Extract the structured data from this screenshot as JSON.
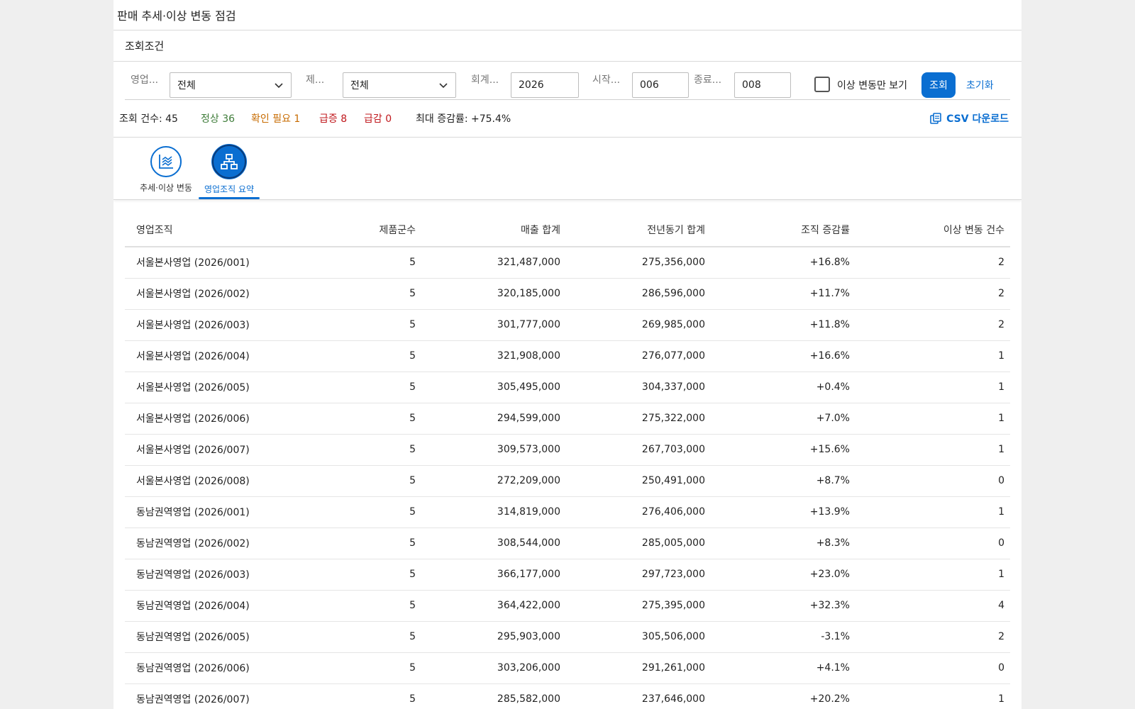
{
  "app": {
    "title": "판매 추세·이상 변동 점검"
  },
  "filters": {
    "header": "조회조건",
    "org_label": "영업...",
    "org_value": "전체",
    "product_label": "제...",
    "product_value": "전체",
    "year_label": "회계...",
    "year_value": "2026",
    "start_label": "시작...",
    "start_value": "006",
    "end_label": "종료...",
    "end_value": "008",
    "anomaly_only_label": "이상 변동만 보기",
    "anomaly_only_checked": false,
    "search_button": "조회",
    "reset_button": "초기화"
  },
  "summary": {
    "count": "조회 건수: 45",
    "normal": "정상 36",
    "check": "확인 필요 1",
    "surge": "급증 8",
    "drop": "급감 0",
    "max_rate": "최대 증감률: +75.4%",
    "csv": "CSV 다운로드",
    "colors": {
      "normal": "#3f7d3a",
      "check": "#c76b00",
      "surge": "#c0181d",
      "drop": "#c0181d"
    }
  },
  "tabs": [
    {
      "label": "추세·이상 변동",
      "icon": "trend-chart-icon",
      "active": false
    },
    {
      "label": "영업조직 요약",
      "icon": "org-hierarchy-icon",
      "active": true
    }
  ],
  "table": {
    "headers": [
      "영업조직",
      "제품군수",
      "매출 합계",
      "전년동기 합계",
      "조직 증감률",
      "이상 변동 건수"
    ],
    "rows": [
      [
        "서울본사영업 (2026/001)",
        "5",
        "321,487,000",
        "275,356,000",
        "+16.8%",
        "2"
      ],
      [
        "서울본사영업 (2026/002)",
        "5",
        "320,185,000",
        "286,596,000",
        "+11.7%",
        "2"
      ],
      [
        "서울본사영업 (2026/003)",
        "5",
        "301,777,000",
        "269,985,000",
        "+11.8%",
        "2"
      ],
      [
        "서울본사영업 (2026/004)",
        "5",
        "321,908,000",
        "276,077,000",
        "+16.6%",
        "1"
      ],
      [
        "서울본사영업 (2026/005)",
        "5",
        "305,495,000",
        "304,337,000",
        "+0.4%",
        "1"
      ],
      [
        "서울본사영업 (2026/006)",
        "5",
        "294,599,000",
        "275,322,000",
        "+7.0%",
        "1"
      ],
      [
        "서울본사영업 (2026/007)",
        "5",
        "309,573,000",
        "267,703,000",
        "+15.6%",
        "1"
      ],
      [
        "서울본사영업 (2026/008)",
        "5",
        "272,209,000",
        "250,491,000",
        "+8.7%",
        "0"
      ],
      [
        "동남권역영업 (2026/001)",
        "5",
        "314,819,000",
        "276,406,000",
        "+13.9%",
        "1"
      ],
      [
        "동남권역영업 (2026/002)",
        "5",
        "308,544,000",
        "285,005,000",
        "+8.3%",
        "0"
      ],
      [
        "동남권역영업 (2026/003)",
        "5",
        "366,177,000",
        "297,723,000",
        "+23.0%",
        "1"
      ],
      [
        "동남권역영업 (2026/004)",
        "5",
        "364,422,000",
        "275,395,000",
        "+32.3%",
        "4"
      ],
      [
        "동남권역영업 (2026/005)",
        "5",
        "295,903,000",
        "305,506,000",
        "-3.1%",
        "2"
      ],
      [
        "동남권역영업 (2026/006)",
        "5",
        "303,206,000",
        "291,261,000",
        "+4.1%",
        "0"
      ],
      [
        "동남권역영업 (2026/007)",
        "5",
        "285,582,000",
        "237,646,000",
        "+20.2%",
        "1"
      ]
    ]
  }
}
